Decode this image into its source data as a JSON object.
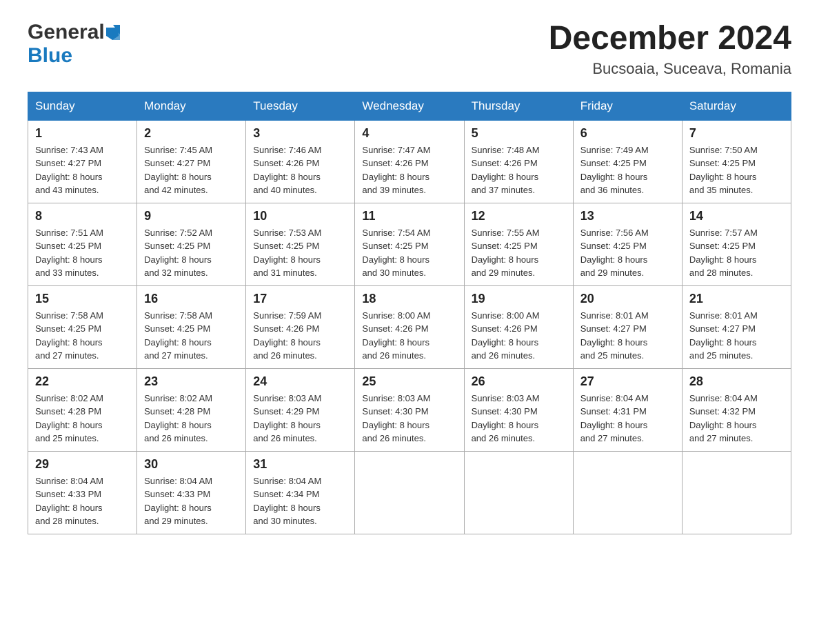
{
  "header": {
    "logo_general": "General",
    "logo_blue": "Blue",
    "title": "December 2024",
    "location": "Bucsoaia, Suceava, Romania"
  },
  "days_of_week": [
    "Sunday",
    "Monday",
    "Tuesday",
    "Wednesday",
    "Thursday",
    "Friday",
    "Saturday"
  ],
  "weeks": [
    [
      {
        "day": "1",
        "sunrise": "7:43 AM",
        "sunset": "4:27 PM",
        "daylight": "8 hours and 43 minutes."
      },
      {
        "day": "2",
        "sunrise": "7:45 AM",
        "sunset": "4:27 PM",
        "daylight": "8 hours and 42 minutes."
      },
      {
        "day": "3",
        "sunrise": "7:46 AM",
        "sunset": "4:26 PM",
        "daylight": "8 hours and 40 minutes."
      },
      {
        "day": "4",
        "sunrise": "7:47 AM",
        "sunset": "4:26 PM",
        "daylight": "8 hours and 39 minutes."
      },
      {
        "day": "5",
        "sunrise": "7:48 AM",
        "sunset": "4:26 PM",
        "daylight": "8 hours and 37 minutes."
      },
      {
        "day": "6",
        "sunrise": "7:49 AM",
        "sunset": "4:25 PM",
        "daylight": "8 hours and 36 minutes."
      },
      {
        "day": "7",
        "sunrise": "7:50 AM",
        "sunset": "4:25 PM",
        "daylight": "8 hours and 35 minutes."
      }
    ],
    [
      {
        "day": "8",
        "sunrise": "7:51 AM",
        "sunset": "4:25 PM",
        "daylight": "8 hours and 33 minutes."
      },
      {
        "day": "9",
        "sunrise": "7:52 AM",
        "sunset": "4:25 PM",
        "daylight": "8 hours and 32 minutes."
      },
      {
        "day": "10",
        "sunrise": "7:53 AM",
        "sunset": "4:25 PM",
        "daylight": "8 hours and 31 minutes."
      },
      {
        "day": "11",
        "sunrise": "7:54 AM",
        "sunset": "4:25 PM",
        "daylight": "8 hours and 30 minutes."
      },
      {
        "day": "12",
        "sunrise": "7:55 AM",
        "sunset": "4:25 PM",
        "daylight": "8 hours and 29 minutes."
      },
      {
        "day": "13",
        "sunrise": "7:56 AM",
        "sunset": "4:25 PM",
        "daylight": "8 hours and 29 minutes."
      },
      {
        "day": "14",
        "sunrise": "7:57 AM",
        "sunset": "4:25 PM",
        "daylight": "8 hours and 28 minutes."
      }
    ],
    [
      {
        "day": "15",
        "sunrise": "7:58 AM",
        "sunset": "4:25 PM",
        "daylight": "8 hours and 27 minutes."
      },
      {
        "day": "16",
        "sunrise": "7:58 AM",
        "sunset": "4:25 PM",
        "daylight": "8 hours and 27 minutes."
      },
      {
        "day": "17",
        "sunrise": "7:59 AM",
        "sunset": "4:26 PM",
        "daylight": "8 hours and 26 minutes."
      },
      {
        "day": "18",
        "sunrise": "8:00 AM",
        "sunset": "4:26 PM",
        "daylight": "8 hours and 26 minutes."
      },
      {
        "day": "19",
        "sunrise": "8:00 AM",
        "sunset": "4:26 PM",
        "daylight": "8 hours and 26 minutes."
      },
      {
        "day": "20",
        "sunrise": "8:01 AM",
        "sunset": "4:27 PM",
        "daylight": "8 hours and 25 minutes."
      },
      {
        "day": "21",
        "sunrise": "8:01 AM",
        "sunset": "4:27 PM",
        "daylight": "8 hours and 25 minutes."
      }
    ],
    [
      {
        "day": "22",
        "sunrise": "8:02 AM",
        "sunset": "4:28 PM",
        "daylight": "8 hours and 25 minutes."
      },
      {
        "day": "23",
        "sunrise": "8:02 AM",
        "sunset": "4:28 PM",
        "daylight": "8 hours and 26 minutes."
      },
      {
        "day": "24",
        "sunrise": "8:03 AM",
        "sunset": "4:29 PM",
        "daylight": "8 hours and 26 minutes."
      },
      {
        "day": "25",
        "sunrise": "8:03 AM",
        "sunset": "4:30 PM",
        "daylight": "8 hours and 26 minutes."
      },
      {
        "day": "26",
        "sunrise": "8:03 AM",
        "sunset": "4:30 PM",
        "daylight": "8 hours and 26 minutes."
      },
      {
        "day": "27",
        "sunrise": "8:04 AM",
        "sunset": "4:31 PM",
        "daylight": "8 hours and 27 minutes."
      },
      {
        "day": "28",
        "sunrise": "8:04 AM",
        "sunset": "4:32 PM",
        "daylight": "8 hours and 27 minutes."
      }
    ],
    [
      {
        "day": "29",
        "sunrise": "8:04 AM",
        "sunset": "4:33 PM",
        "daylight": "8 hours and 28 minutes."
      },
      {
        "day": "30",
        "sunrise": "8:04 AM",
        "sunset": "4:33 PM",
        "daylight": "8 hours and 29 minutes."
      },
      {
        "day": "31",
        "sunrise": "8:04 AM",
        "sunset": "4:34 PM",
        "daylight": "8 hours and 30 minutes."
      },
      null,
      null,
      null,
      null
    ]
  ],
  "labels": {
    "sunrise": "Sunrise:",
    "sunset": "Sunset:",
    "daylight": "Daylight:"
  }
}
